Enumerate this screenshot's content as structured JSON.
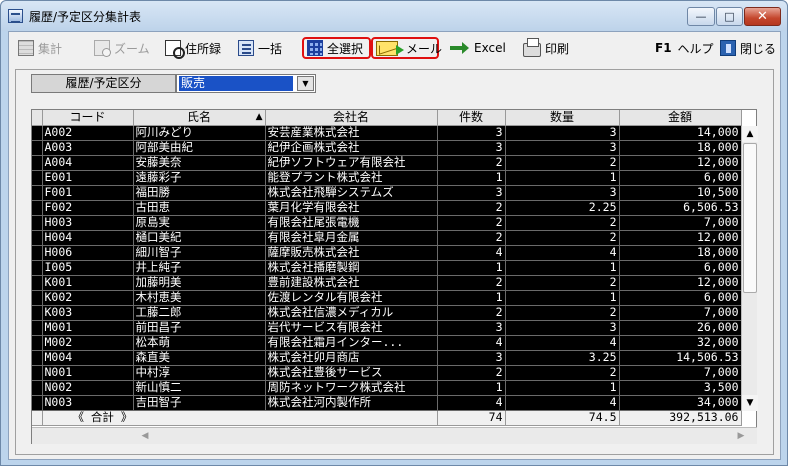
{
  "window": {
    "title": "履歴/予定区分集計表",
    "min_label": "—",
    "max_label": "□",
    "close_label": "✕"
  },
  "toolbar": {
    "tally": "集計",
    "zoom": "ズーム",
    "address": "住所録",
    "batch": "一括",
    "select_all": "全選択",
    "mail": "メール",
    "excel": "Excel",
    "print": "印刷",
    "help_key": "F1",
    "help": "ヘルプ",
    "close": "閉じる"
  },
  "filter": {
    "label": "履歴/予定区分",
    "value": "販売"
  },
  "grid": {
    "columns": [
      "コード",
      "氏名",
      "会社名",
      "件数",
      "数量",
      "金額"
    ],
    "sort_indicator": "▲",
    "rows": [
      [
        "A002",
        "阿川みどり",
        "安芸産業株式会社",
        "3",
        "3",
        "14,000"
      ],
      [
        "A003",
        "阿部美由紀",
        "紀伊企画株式会社",
        "3",
        "3",
        "18,000"
      ],
      [
        "A004",
        "安藤美奈",
        "紀伊ソフトウェア有限会社",
        "2",
        "2",
        "12,000"
      ],
      [
        "E001",
        "遠藤彩子",
        "能登プラント株式会社",
        "1",
        "1",
        "6,000"
      ],
      [
        "F001",
        "福田勝",
        "株式会社飛騨システムズ",
        "3",
        "3",
        "10,500"
      ],
      [
        "F002",
        "古田恵",
        "葉月化学有限会社",
        "2",
        "2.25",
        "6,506.53"
      ],
      [
        "H003",
        "原島実",
        "有限会社尾張電機",
        "2",
        "2",
        "7,000"
      ],
      [
        "H004",
        "樋口美紀",
        "有限会社皐月金属",
        "2",
        "2",
        "12,000"
      ],
      [
        "H006",
        "細川智子",
        "薩摩販売株式会社",
        "4",
        "4",
        "18,000"
      ],
      [
        "I005",
        "井上純子",
        "株式会社播磨製鋼",
        "1",
        "1",
        "6,000"
      ],
      [
        "K001",
        "加藤明美",
        "豊前建設株式会社",
        "2",
        "2",
        "12,000"
      ],
      [
        "K002",
        "木村恵美",
        "佐渡レンタル有限会社",
        "1",
        "1",
        "6,000"
      ],
      [
        "K003",
        "工藤二郎",
        "株式会社信濃メディカル",
        "2",
        "2",
        "7,000"
      ],
      [
        "M001",
        "前田昌子",
        "岩代サービス有限会社",
        "3",
        "3",
        "26,000"
      ],
      [
        "M002",
        "松本萌",
        "有限会社霜月インター...",
        "4",
        "4",
        "32,000"
      ],
      [
        "M004",
        "森直美",
        "株式会社卯月商店",
        "3",
        "3.25",
        "14,506.53"
      ],
      [
        "N001",
        "中村淳",
        "株式会社豊後サービス",
        "2",
        "2",
        "7,000"
      ],
      [
        "N002",
        "新山慎二",
        "周防ネットワーク株式会社",
        "1",
        "1",
        "3,500"
      ],
      [
        "N003",
        "吉田智子",
        "株式会社河内製作所",
        "4",
        "4",
        "34,000"
      ]
    ],
    "total": {
      "label": "《 合計 》",
      "count": "74",
      "quantity": "74.5",
      "amount": "392,513.06"
    }
  },
  "colors": {
    "grid_bg": "#000000",
    "grid_text": "#ffffff",
    "highlight_border": "#e01010",
    "selection": "#1a52c6"
  }
}
